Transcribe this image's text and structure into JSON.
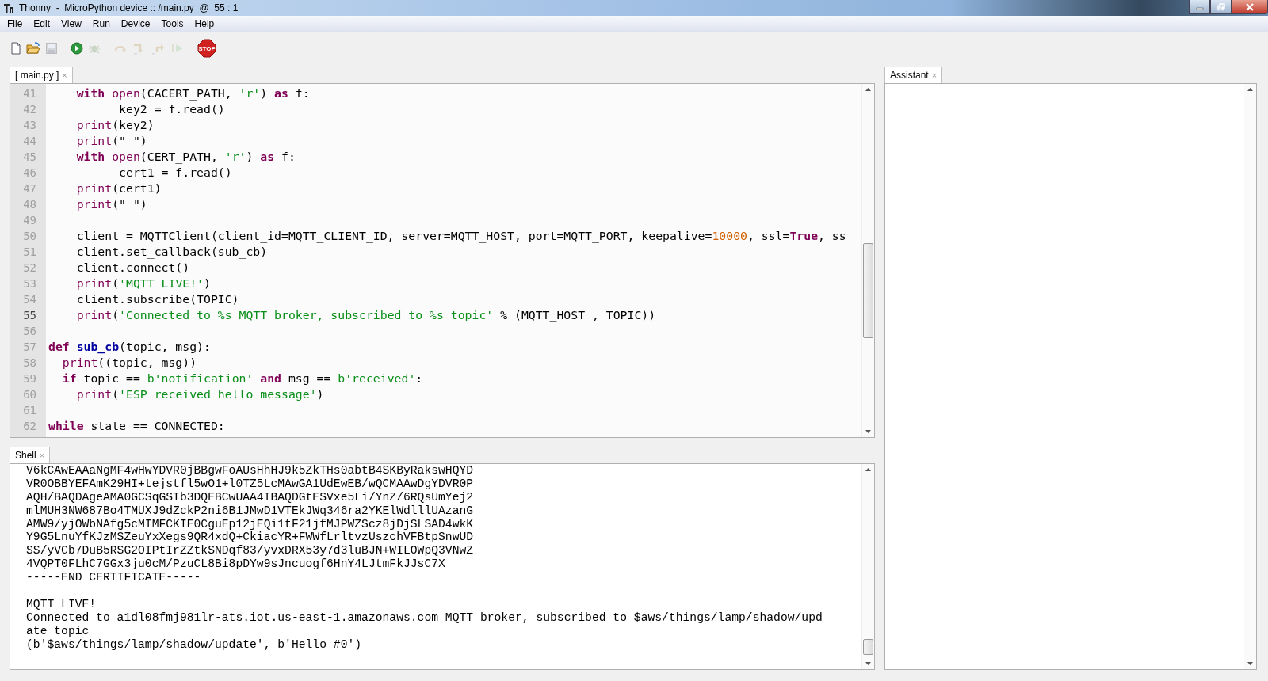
{
  "window": {
    "title": "Thonny  -  MicroPython device :: /main.py  @  55 : 1"
  },
  "menu": [
    "File",
    "Edit",
    "View",
    "Run",
    "Device",
    "Tools",
    "Help"
  ],
  "toolbar": [
    {
      "kind": "new",
      "disabled": false
    },
    {
      "kind": "open",
      "disabled": false
    },
    {
      "kind": "save",
      "disabled": true
    },
    {
      "kind": "run",
      "disabled": false
    },
    {
      "kind": "debug",
      "disabled": true
    },
    {
      "kind": "step_over",
      "disabled": true
    },
    {
      "kind": "step_into",
      "disabled": true
    },
    {
      "kind": "step_out",
      "disabled": true
    },
    {
      "kind": "resume",
      "disabled": true
    },
    {
      "kind": "stop",
      "disabled": false,
      "label": "STOP"
    }
  ],
  "editor": {
    "tab": "[ main.py ]",
    "close": "×",
    "lines": [
      {
        "number": "41",
        "current": false,
        "tokens": [
          {
            "text": "    with",
            "kind": "keyword"
          },
          {
            "text": " open",
            "kind": "builtin"
          },
          {
            "text": "(CACERT_PATH, ",
            "kind": "plain"
          },
          {
            "text": "'r'",
            "kind": "string"
          },
          {
            "text": ") ",
            "kind": "plain"
          },
          {
            "text": "as",
            "kind": "keyword"
          },
          {
            "text": " f:",
            "kind": "plain"
          }
        ]
      },
      {
        "number": "42",
        "current": false,
        "tokens": [
          {
            "text": "          key2 = f.read()",
            "kind": "plain"
          }
        ]
      },
      {
        "number": "43",
        "current": false,
        "tokens": [
          {
            "text": "    print",
            "kind": "builtin"
          },
          {
            "text": "(key2)",
            "kind": "plain"
          }
        ]
      },
      {
        "number": "44",
        "current": false,
        "tokens": [
          {
            "text": "    print",
            "kind": "builtin"
          },
          {
            "text": "(\" \")",
            "kind": "plain"
          }
        ]
      },
      {
        "number": "45",
        "current": false,
        "tokens": [
          {
            "text": "    with",
            "kind": "keyword"
          },
          {
            "text": " open",
            "kind": "builtin"
          },
          {
            "text": "(CERT_PATH, ",
            "kind": "plain"
          },
          {
            "text": "'r'",
            "kind": "string"
          },
          {
            "text": ") ",
            "kind": "plain"
          },
          {
            "text": "as",
            "kind": "keyword"
          },
          {
            "text": " f:",
            "kind": "plain"
          }
        ]
      },
      {
        "number": "46",
        "current": false,
        "tokens": [
          {
            "text": "          cert1 = f.read()",
            "kind": "plain"
          }
        ]
      },
      {
        "number": "47",
        "current": false,
        "tokens": [
          {
            "text": "    print",
            "kind": "builtin"
          },
          {
            "text": "(cert1)",
            "kind": "plain"
          }
        ]
      },
      {
        "number": "48",
        "current": false,
        "tokens": [
          {
            "text": "    print",
            "kind": "builtin"
          },
          {
            "text": "(\" \")",
            "kind": "plain"
          }
        ]
      },
      {
        "number": "49",
        "current": false
      },
      {
        "number": "50",
        "current": false,
        "tokens": [
          {
            "text": "    client = MQTTClient(client_id=MQTT_CLIENT_ID, server=MQTT_HOST, port=MQTT_PORT, keepalive=",
            "kind": "plain"
          },
          {
            "text": "10000",
            "kind": "number"
          },
          {
            "text": ", ssl=",
            "kind": "plain"
          },
          {
            "text": "True",
            "kind": "keyword"
          },
          {
            "text": ", ss",
            "kind": "plain"
          }
        ]
      },
      {
        "number": "51",
        "current": false,
        "tokens": [
          {
            "text": "    client.set_callback(sub_cb)",
            "kind": "plain"
          }
        ]
      },
      {
        "number": "52",
        "current": false,
        "tokens": [
          {
            "text": "    client.connect()",
            "kind": "plain"
          }
        ]
      },
      {
        "number": "53",
        "current": false,
        "tokens": [
          {
            "text": "    print",
            "kind": "builtin"
          },
          {
            "text": "(",
            "kind": "plain"
          },
          {
            "text": "'MQTT LIVE!'",
            "kind": "string"
          },
          {
            "text": ")",
            "kind": "plain"
          }
        ]
      },
      {
        "number": "54",
        "current": false,
        "tokens": [
          {
            "text": "    client.subscribe(TOPIC)",
            "kind": "plain"
          }
        ]
      },
      {
        "number": "55",
        "current": true,
        "tokens": [
          {
            "text": "    print",
            "kind": "builtin"
          },
          {
            "text": "(",
            "kind": "plain"
          },
          {
            "text": "'Connected to %s MQTT broker, subscribed to %s topic'",
            "kind": "string"
          },
          {
            "text": " % (MQTT_HOST , TOPIC))",
            "kind": "plain"
          }
        ]
      },
      {
        "number": "56",
        "current": false
      },
      {
        "number": "57",
        "current": false,
        "tokens": [
          {
            "text": "def",
            "kind": "keyword"
          },
          {
            "text": " sub_cb",
            "kind": "function"
          },
          {
            "text": "(topic, msg):",
            "kind": "plain"
          }
        ]
      },
      {
        "number": "58",
        "current": false,
        "tokens": [
          {
            "text": "  print",
            "kind": "builtin"
          },
          {
            "text": "((topic, msg))",
            "kind": "plain"
          }
        ]
      },
      {
        "number": "59",
        "current": false,
        "tokens": [
          {
            "text": "  if",
            "kind": "keyword"
          },
          {
            "text": " topic == ",
            "kind": "plain"
          },
          {
            "text": "b'notification'",
            "kind": "string"
          },
          {
            "text": " and",
            "kind": "keyword"
          },
          {
            "text": " msg == ",
            "kind": "plain"
          },
          {
            "text": "b'received'",
            "kind": "string"
          },
          {
            "text": ":",
            "kind": "plain"
          }
        ]
      },
      {
        "number": "60",
        "current": false,
        "tokens": [
          {
            "text": "    print",
            "kind": "builtin"
          },
          {
            "text": "(",
            "kind": "plain"
          },
          {
            "text": "'ESP received hello message'",
            "kind": "string"
          },
          {
            "text": ")",
            "kind": "plain"
          }
        ]
      },
      {
        "number": "61",
        "current": false
      },
      {
        "number": "62",
        "current": false,
        "tokens": [
          {
            "text": "while",
            "kind": "keyword"
          },
          {
            "text": " state == CONNECTED:",
            "kind": "plain"
          }
        ]
      }
    ]
  },
  "shell": {
    "tab": "Shell",
    "close": "×",
    "blocks": [
      [
        "V6kCAwEAAaNgMF4wHwYDVR0jBBgwFoAUsHhHJ9k5ZkTHs0abtB4SKByRakswHQYD",
        "VR0OBBYEFAmK29HI+tejstfl5wO1+l0TZ5LcMAwGA1UdEwEB/wQCMAAwDgYDVR0P",
        "AQH/BAQDAgeAMA0GCSqGSIb3DQEBCwUAA4IBAQDGtESVxe5Li/YnZ/6RQsUmYej2",
        "mlMUH3NW687Bo4TMUXJ9dZckP2ni6B1JMwD1VTEkJWq346ra2YKElWdlllUAzanG",
        "AMW9/yjOWbNAfg5cMIMFCKIE0CguEp12jEQi1tF21jfMJPWZScz8jDjSLSAD4wkK",
        "Y9G5LnuYfKJzMSZeuYxXegs9QR4xdQ+CkiacYR+FWWfLrltvzUszchVFBtpSnwUD",
        "SS/yVCb7DuB5RSG2OIPtIrZZtkSNDqf83/yvxDRX53y7d3luBJN+WILOWpQ3VNwZ",
        "4VQPT0FLhC7GGx3ju0cM/PzuCL8Bi8pDYw9sJncuogf6HnY4LJtmFkJJsC7X",
        "-----END CERTIFICATE-----"
      ],
      [
        "MQTT LIVE!",
        "Connected to a1dl08fmj981lr-ats.iot.us-east-1.amazonaws.com MQTT broker, subscribed to $aws/things/lamp/shadow/upd",
        "ate topic",
        "(b'$aws/things/lamp/shadow/update', b'Hello #0')"
      ]
    ]
  },
  "assistant": {
    "tab": "Assistant",
    "close": "×"
  }
}
